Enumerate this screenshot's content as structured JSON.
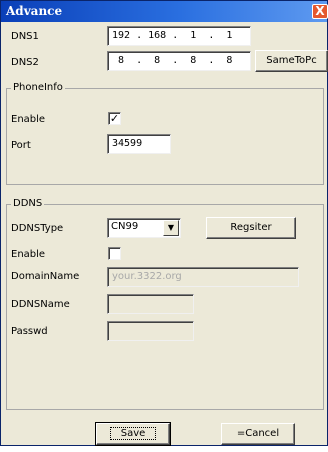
{
  "window": {
    "title": "Advance",
    "close_glyph": "X"
  },
  "dns": {
    "dns1_label": "DNS1",
    "dns1_value": "192 . 168 .  1  .  1",
    "dns2_label": "DNS2",
    "dns2_value": " 8  .  8  .  8  .  8",
    "same_to_pc_label": "SameToPc"
  },
  "phone_info": {
    "group_title": "PhoneInfo",
    "enable_label": "Enable",
    "enable_checked": true,
    "enable_check_glyph": "✓",
    "port_label": "Port",
    "port_value": "34599"
  },
  "ddns": {
    "group_title": "DDNS",
    "type_label": "DDNSType",
    "type_value": "CN99",
    "type_arrow_glyph": "▼",
    "register_label": "Regsiter",
    "enable_label": "Enable",
    "enable_checked": false,
    "domain_label": "DomainName",
    "domain_placeholder": "your.3322.org",
    "ddnsname_label": "DDNSName",
    "ddnsname_value": "",
    "passwd_label": "Passwd",
    "passwd_value": ""
  },
  "footer": {
    "save_label": "Save",
    "cancel_label": "=Cancel"
  }
}
